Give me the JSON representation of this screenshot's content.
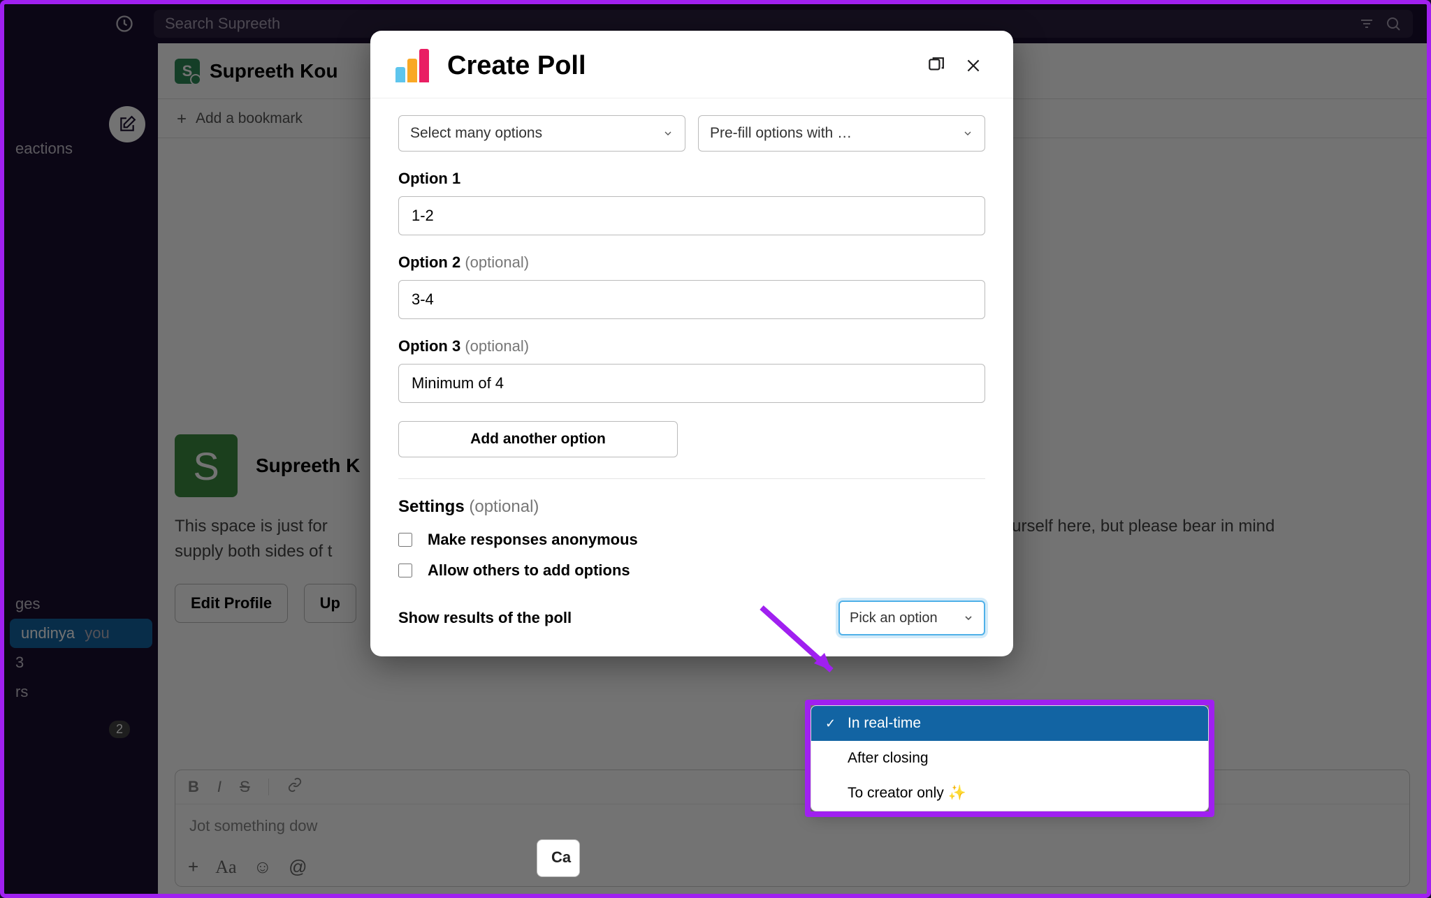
{
  "search": {
    "placeholder": "Search Supreeth"
  },
  "sidebar": {
    "items": [
      {
        "label": "eactions"
      },
      {
        "label": "ges"
      },
      {
        "label": "undinya",
        "suffix": "you",
        "active": true
      },
      {
        "label": "3"
      },
      {
        "label": "rs"
      }
    ],
    "badge": "2"
  },
  "channel": {
    "avatar_letter": "S",
    "title": "Supreeth Kou"
  },
  "bookmark": {
    "label": "Add a bookmark"
  },
  "welcome": {
    "avatar_letter": "S",
    "name": "Supreeth K",
    "text_line1": "This space is just for",
    "text_line2": "talk to yourself here, but please bear in mind",
    "text_line3": "supply both sides of t",
    "buttons": {
      "edit": "Edit Profile",
      "up": "Up"
    }
  },
  "composer": {
    "placeholder": "Jot something dow",
    "fmt": {
      "bold": "B",
      "italic": "I",
      "strike": "S"
    },
    "actions": {
      "plus": "+",
      "aa": "Aa",
      "emoji": "☺",
      "mention": "@"
    }
  },
  "modal": {
    "title": "Create Poll",
    "select1": "Select many options",
    "select2": "Pre-fill options with …",
    "options": [
      {
        "label": "Option 1",
        "optional": "",
        "value": "1-2"
      },
      {
        "label": "Option 2",
        "optional": "(optional)",
        "value": "3-4"
      },
      {
        "label": "Option 3",
        "optional": "(optional)",
        "value": "Minimum of 4"
      }
    ],
    "add_button": "Add another option",
    "settings_label": "Settings",
    "settings_optional": "(optional)",
    "check1": "Make responses anonymous",
    "check2": "Allow others to add options",
    "results_label": "Show results of the poll",
    "pick_label": "Pick an option",
    "cancel": "Ca"
  },
  "dropdown": {
    "items": [
      {
        "label": "In real-time",
        "selected": true
      },
      {
        "label": "After closing",
        "selected": false
      },
      {
        "label": "To creator only ✨",
        "selected": false
      }
    ]
  }
}
